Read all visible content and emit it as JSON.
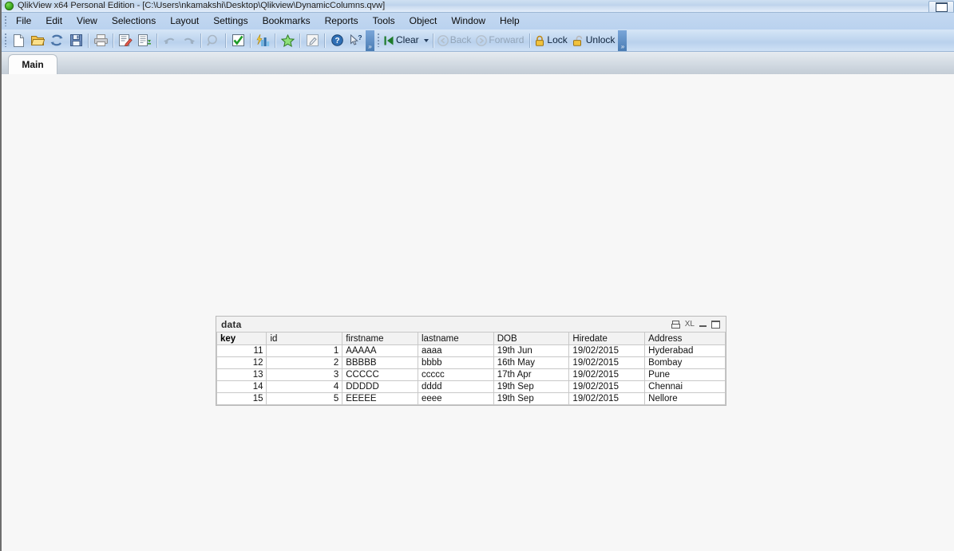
{
  "window": {
    "title": "QlikView x64 Personal Edition - [C:\\Users\\nkamakshi\\Desktop\\Qlikview\\DynamicColumns.qvw]",
    "logo_icon": "qlikview-logo-icon",
    "restore_button_icon": "restore-window-icon"
  },
  "menubar": {
    "items": [
      {
        "label": "File"
      },
      {
        "label": "Edit"
      },
      {
        "label": "View"
      },
      {
        "label": "Selections"
      },
      {
        "label": "Layout"
      },
      {
        "label": "Settings"
      },
      {
        "label": "Bookmarks"
      },
      {
        "label": "Reports"
      },
      {
        "label": "Tools"
      },
      {
        "label": "Object"
      },
      {
        "label": "Window"
      },
      {
        "label": "Help"
      }
    ]
  },
  "toolbar": {
    "buttons": [
      {
        "name": "new-document-icon",
        "title": "New"
      },
      {
        "name": "open-document-icon",
        "title": "Open"
      },
      {
        "name": "reload-icon",
        "title": "Reload"
      },
      {
        "name": "save-icon",
        "title": "Save"
      },
      {
        "name": "print-icon",
        "title": "Print"
      },
      {
        "name": "edit-script-icon",
        "title": "Edit Script"
      },
      {
        "name": "table-viewer-icon",
        "title": "Table Viewer"
      },
      {
        "name": "undo-icon",
        "title": "Undo"
      },
      {
        "name": "redo-icon",
        "title": "Redo"
      },
      {
        "name": "search-icon",
        "title": "Search"
      },
      {
        "name": "select-possible-icon",
        "title": "Select Possible"
      },
      {
        "name": "quick-chart-icon",
        "title": "Quick Chart Wizard"
      },
      {
        "name": "favorites-icon",
        "title": "Add Bookmark"
      },
      {
        "name": "design-grid-icon",
        "title": "Design Grid"
      },
      {
        "name": "help-icon",
        "title": "Help"
      },
      {
        "name": "context-help-icon",
        "title": "Context Help"
      }
    ],
    "overflow_label": "»",
    "clear_label": "Clear",
    "clear_icon": "clear-selections-icon",
    "back_label": "Back",
    "back_icon": "back-arrow-icon",
    "forward_label": "Forward",
    "forward_icon": "forward-arrow-icon",
    "lock_label": "Lock",
    "lock_icon": "padlock-closed-icon",
    "unlock_label": "Unlock",
    "unlock_icon": "padlock-open-icon"
  },
  "tabs": [
    {
      "label": "Main",
      "active": true
    }
  ],
  "table_object": {
    "caption": "data",
    "icons": [
      {
        "name": "print-object-icon"
      },
      {
        "name": "export-to-excel-icon",
        "label": "XL"
      },
      {
        "name": "minimize-object-icon"
      },
      {
        "name": "maximize-object-icon"
      }
    ],
    "columns": [
      {
        "label": "key",
        "align": "num",
        "dimension": true
      },
      {
        "label": "id",
        "align": "num",
        "dimension": false
      },
      {
        "label": "firstname",
        "align": "txt",
        "dimension": false
      },
      {
        "label": "lastname",
        "align": "txt",
        "dimension": false
      },
      {
        "label": "DOB",
        "align": "txt",
        "dimension": false
      },
      {
        "label": "Hiredate",
        "align": "txt",
        "dimension": false
      },
      {
        "label": "Address",
        "align": "txt",
        "dimension": false
      }
    ],
    "rows": [
      [
        "11",
        "1",
        "AAAAA",
        "aaaa",
        "19th Jun",
        "19/02/2015",
        "Hyderabad"
      ],
      [
        "12",
        "2",
        "BBBBB",
        "bbbb",
        "16th May",
        "19/02/2015",
        "Bombay"
      ],
      [
        "13",
        "3",
        "CCCCC",
        "ccccc",
        "17th Apr",
        "19/02/2015",
        "Pune"
      ],
      [
        "14",
        "4",
        "DDDDD",
        "dddd",
        "19th Sep",
        "19/02/2015",
        "Chennai"
      ],
      [
        "15",
        "5",
        "EEEEE",
        "eeee",
        "19th Sep",
        "19/02/2015",
        "Nellore"
      ]
    ]
  },
  "colors": {
    "titlebar": "#bed4ec",
    "menubar": "#bad2ef",
    "workspace": "#f7f7f7",
    "table_header": "#f2f2f2",
    "grid_line": "#c8c8c8"
  }
}
